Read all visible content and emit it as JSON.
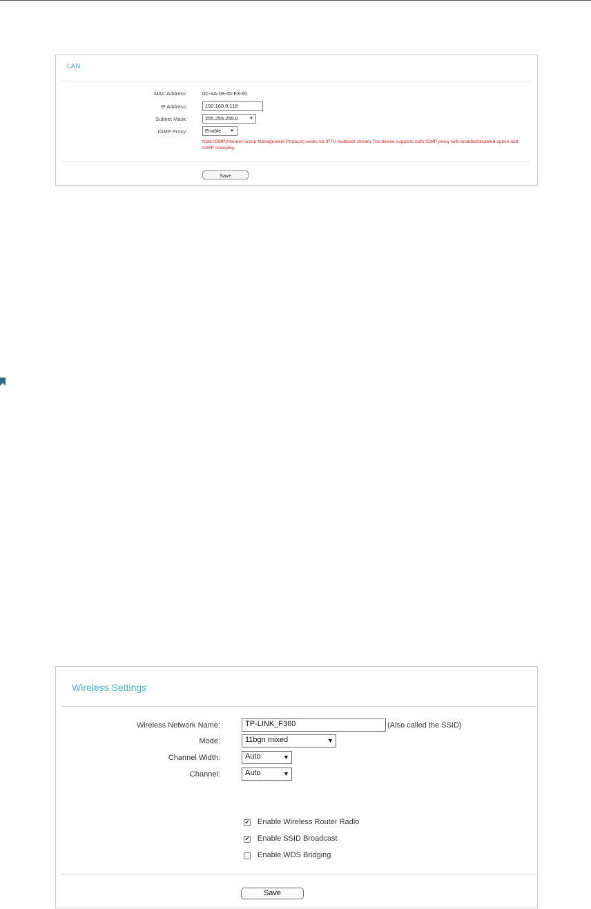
{
  "colors": {
    "accent": "#4fb2d6",
    "note": "#e8231c"
  },
  "lan": {
    "title": "LAN",
    "mac_label": "MAC Address:",
    "mac_value": "0C-4A-08-45-F3-60",
    "ip_label": "IP Address:",
    "ip_value": "192.168.0.118",
    "mask_label": "Subnet Mask:",
    "mask_value": "255.255.255.0",
    "igmp_label": "IGMP Proxy:",
    "igmp_value": "Enable",
    "note": "Note:IGMP(Internet Group Management Protocol) works for IPTV multicast stream.The device supports both IGMP proxy with enabled/disabled option and IGMP snooping.",
    "save_label": "Save"
  },
  "wireless": {
    "title": "Wireless Settings",
    "ssid_label": "Wireless Network Name:",
    "ssid_value": "TP-LINK_F360",
    "ssid_hint": "(Also called the SSID)",
    "mode_label": "Mode:",
    "mode_value": "11bgn mixed",
    "width_label": "Channel Width:",
    "width_value": "Auto",
    "channel_label": "Channel:",
    "channel_value": "Auto",
    "checkboxes": [
      {
        "label": "Enable Wireless Router Radio",
        "checked": true
      },
      {
        "label": "Enable SSID Broadcast",
        "checked": true
      },
      {
        "label": "Enable WDS Bridging",
        "checked": false
      }
    ],
    "save_label": "Save"
  }
}
